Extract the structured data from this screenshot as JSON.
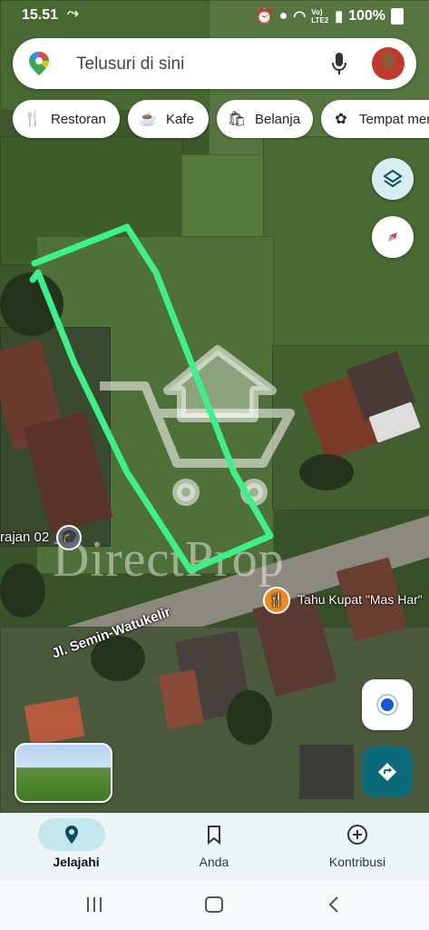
{
  "status_bar": {
    "time": "15.51",
    "battery_text": "100%",
    "network_text": "Vo) LTE2"
  },
  "search": {
    "placeholder": "Telusuri di sini",
    "mic_icon": "mic-icon",
    "avatar_icon": "profile-avatar"
  },
  "chips": [
    {
      "label": "Restoran",
      "icon": "restaurant-icon"
    },
    {
      "label": "Kafe",
      "icon": "coffee-icon"
    },
    {
      "label": "Belanja",
      "icon": "shopping-bag-icon"
    },
    {
      "label": "Tempat mer",
      "icon": "attraction-icon"
    }
  ],
  "map_labels": {
    "school": "rajan 02",
    "road": "Jl. Semin-Watukelir",
    "poi": "Tahu Kupat \"Mas Har\"",
    "watermark": "DirectProp"
  },
  "bottom_nav": {
    "items": [
      {
        "label": "Jelajahi",
        "icon": "explore-pin-icon",
        "active": true
      },
      {
        "label": "Anda",
        "icon": "bookmark-icon",
        "active": false
      },
      {
        "label": "Kontribusi",
        "icon": "add-circle-icon",
        "active": false
      }
    ]
  },
  "colors": {
    "accent": "#0c6b7a",
    "active_pill": "#c4e6ef",
    "boundary": "#3ef08a",
    "locate_dot": "#1a57d6"
  }
}
